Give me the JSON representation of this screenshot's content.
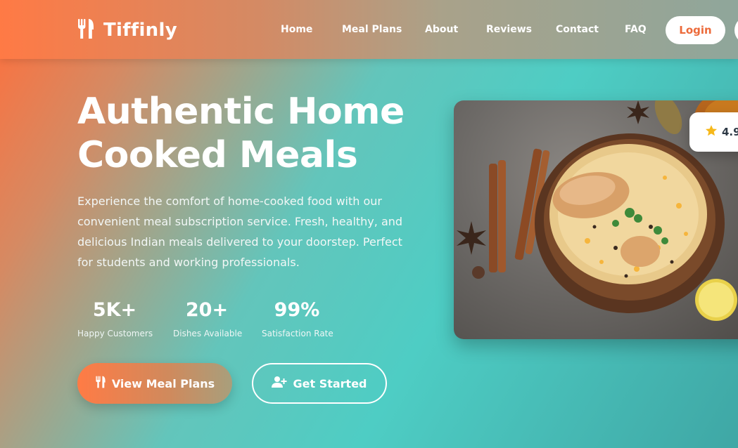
{
  "brand": {
    "name": "Tiffinly",
    "logo_icon": "utensils-icon"
  },
  "nav": {
    "links": [
      "Home",
      "Meal Plans",
      "About",
      "Reviews",
      "Contact",
      "FAQ"
    ],
    "login_label": "Login"
  },
  "hero": {
    "title_line1": "Authentic Home",
    "title_line2": "Cooked Meals",
    "description": "Experience the comfort of home-cooked food with our convenient meal subscription service. Fresh, healthy, and delicious Indian meals delivered to your doorstep. Perfect for students and working professionals.",
    "stats": [
      {
        "value": "5K+",
        "label": "Happy Customers"
      },
      {
        "value": "20+",
        "label": "Dishes Available"
      },
      {
        "value": "99%",
        "label": "Satisfaction Rate"
      }
    ],
    "primary_button": {
      "label": "View Meal Plans",
      "icon": "utensils-icon"
    },
    "secondary_button": {
      "label": "Get Started",
      "icon": "user-plus-icon"
    }
  },
  "food_card": {
    "image": "biryani-bowl-photo",
    "rating": "4.9",
    "rating_icon": "star-icon"
  },
  "colors": {
    "accent_orange": "#ff7043",
    "teal": "#4ecdc4",
    "login_text": "#ec6b3b",
    "star": "#f6b81a"
  }
}
